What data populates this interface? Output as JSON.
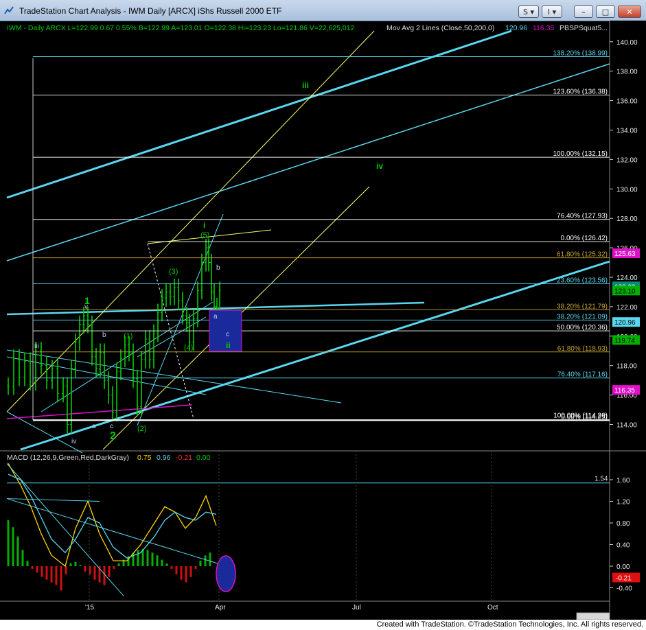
{
  "window": {
    "title": "TradeStation Chart Analysis - IWM Daily [ARCX] iShs Russell 2000 ETF",
    "buttons": {
      "s": "S",
      "i": "I",
      "minimize": "–",
      "maximize": "□",
      "close": "✕"
    }
  },
  "price_panel": {
    "symbol_line": "IWM - Daily ARCX L=122.99 0.67 0.55% B=122.99 A=123.01 O=122.38 Hi=123.23 Lo=121.86 V=22,625,012",
    "ma_label": "Mov Avg 2 Lines (Close,50,200,0)",
    "ma_value_50": "120.96",
    "ma_value_200": "116.35",
    "indicator_label": "PBSPSquat5...",
    "y_axis_labels": [
      "140.00",
      "138.00",
      "136.00",
      "134.00",
      "132.00",
      "130.00",
      "128.00",
      "126.00",
      "124.00",
      "122.00",
      "120.00",
      "118.00",
      "116.00",
      "114.00"
    ],
    "price_tags": [
      "125.63",
      "123.38",
      "123.10",
      "120.96",
      "119.74",
      "116.35"
    ],
    "fib_labels": [
      "138.20% (138.99)",
      "123.60% (136.38)",
      "100.00% (132.15)",
      "76.40% (127.93)",
      "0.00% (126.42)",
      "61.80% (125.32)",
      "23.60% (123.56)",
      "38.20% (121.79)",
      "38.20% (121.09)",
      "50.00% (120.36)",
      "61.80% (118.93)",
      "76.40% (117.16)",
      "100.00% (114.29)",
      "0.00% (114.29)"
    ],
    "wave_labels": [
      "iii",
      "iv",
      "i",
      "(5)",
      "b",
      "(3)",
      "1",
      "v",
      "iii",
      "b",
      "(1)",
      "a",
      "c",
      "ii",
      "(4)",
      "2",
      "a",
      "c",
      "(2)",
      "iv"
    ]
  },
  "macd_panel": {
    "label": "MACD (12,26,9,Green,Red,DarkGray)",
    "values": [
      "0.75",
      "0.96",
      "-0.21",
      "0.00"
    ],
    "y_axis_labels": [
      "1.60",
      "1.20",
      "0.80",
      "0.40",
      "0.00",
      "-0.40"
    ],
    "level_label": "1.54",
    "value_tag": "-0.21"
  },
  "x_axis_labels": [
    "'15",
    "Apr",
    "Jul",
    "Oct"
  ],
  "colors": {
    "green": "#00d000",
    "cyan": "#5ad7ef",
    "magenta": "#e010c8",
    "blue_box": "#1a2a9a"
  },
  "footer": {
    "text": "Created with TradeStation. ©TradeStation Technologies, Inc. All rights reserved."
  }
}
